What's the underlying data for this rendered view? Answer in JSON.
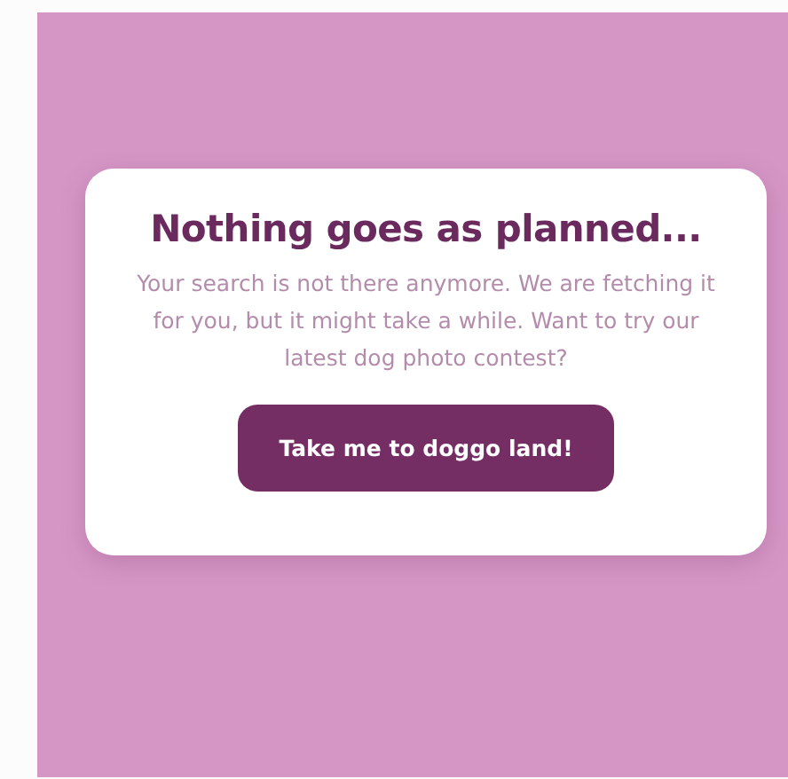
{
  "card": {
    "title": "Nothing goes as planned...",
    "message": "Your search is not there anymore. We are fetching it for you, but it might take a while. Want to try our latest dog photo contest?",
    "button": "Take me to doggo land!"
  }
}
